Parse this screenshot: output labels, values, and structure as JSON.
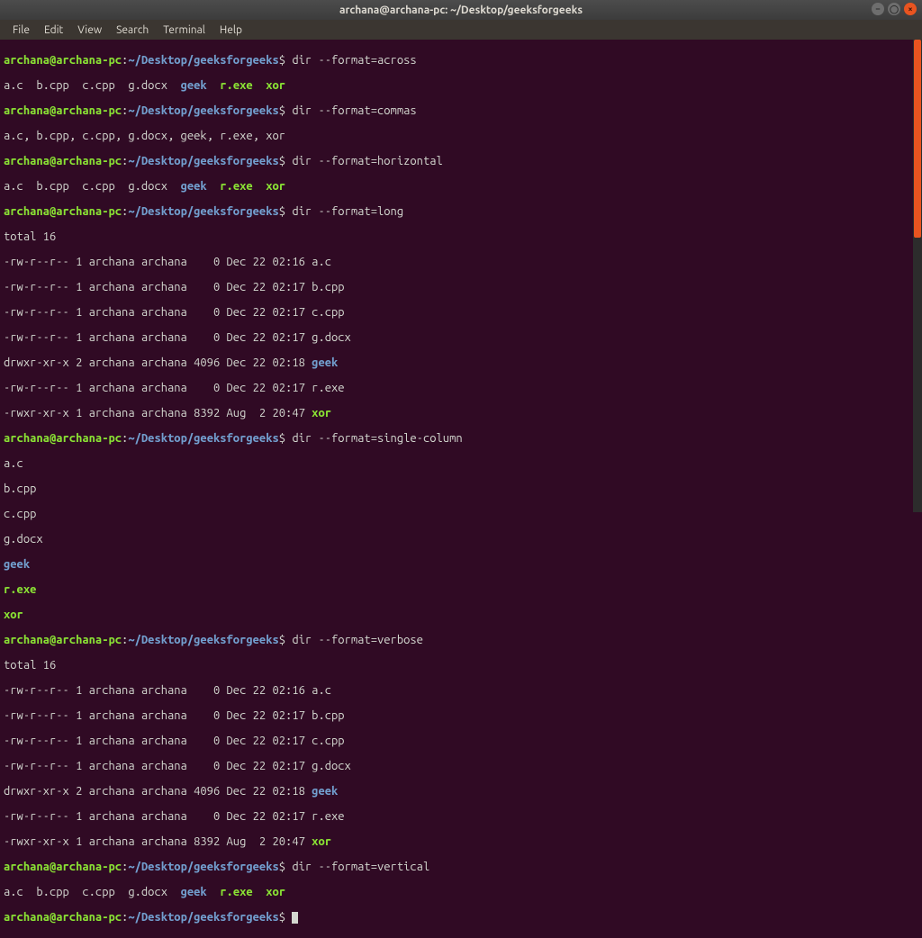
{
  "title": "archana@archana-pc: ~/Desktop/geeksforgeeks",
  "menubar": {
    "file": "File",
    "edit": "Edit",
    "view": "View",
    "search": "Search",
    "terminal": "Terminal",
    "help": "Help"
  },
  "prompt": {
    "userhost": "archana@archana-pc",
    "colon": ":",
    "path": "~/Desktop/geeksforgeeks",
    "dollar": "$"
  },
  "commands": {
    "cmd1": " dir --format=across",
    "cmd2": " dir --format=commas",
    "cmd3": " dir --format=horizontal",
    "cmd4": " dir --format=long",
    "cmd5": " dir --format=single-column",
    "cmd6": " dir --format=verbose",
    "cmd7": " dir --format=vertical",
    "cmd8": " "
  },
  "output": {
    "across": {
      "f1": "a.c  ",
      "f2": "b.cpp  ",
      "f3": "c.cpp  ",
      "f4": "g.docx  ",
      "f5": "geek",
      "f6": "  ",
      "f7": "r.exe",
      "f8": "  ",
      "f9": "xor"
    },
    "commas_line": "a.c, b.cpp, c.cpp, g.docx, geek, r.exe, xor",
    "total": "total 16",
    "long": {
      "l1": "-rw-r--r-- 1 archana archana    0 Dec 22 02:16 a.c",
      "l2": "-rw-r--r-- 1 archana archana    0 Dec 22 02:17 b.cpp",
      "l3": "-rw-r--r-- 1 archana archana    0 Dec 22 02:17 c.cpp",
      "l4": "-rw-r--r-- 1 archana archana    0 Dec 22 02:17 g.docx",
      "l5_a": "drwxr-xr-x 2 archana archana 4096 Dec 22 02:18 ",
      "l5_b": "geek",
      "l6": "-rw-r--r-- 1 archana archana    0 Dec 22 02:17 r.exe",
      "l7_a": "-rwxr-xr-x 1 archana archana 8392 Aug  2 20:47 ",
      "l7_b": "xor"
    },
    "single": {
      "s1": "a.c",
      "s2": "b.cpp",
      "s3": "c.cpp",
      "s4": "g.docx",
      "s5": "geek",
      "s6": "r.exe",
      "s7": "xor"
    }
  }
}
